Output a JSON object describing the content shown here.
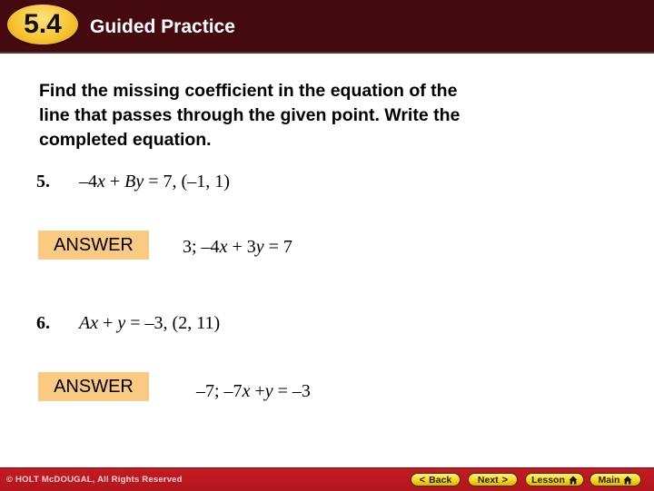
{
  "header": {
    "section_number": "5.4",
    "title": "Guided Practice"
  },
  "instructions": {
    "line1": "Find the missing coefficient in the equation of the",
    "line2": "line that passes through the given point. Write the",
    "line3": "completed equation."
  },
  "problems": [
    {
      "number": "5.",
      "equation_parts": [
        "–4",
        "x",
        " + ",
        "B",
        "y",
        " = 7, (–1, 1)"
      ],
      "answer_label": "ANSWER",
      "answer_parts": [
        "3; –4",
        "x",
        " + 3",
        "y",
        " = 7"
      ]
    },
    {
      "number": "6.",
      "equation_parts": [
        "A",
        "x",
        " + ",
        "y",
        " = –3, (2, 11)"
      ],
      "answer_label": "ANSWER",
      "answer_parts": [
        "–7; –7",
        "x",
        " +",
        "y",
        " = –3"
      ]
    }
  ],
  "footer": {
    "copyright": "© HOLT McDOUGAL, All Rights Reserved",
    "buttons": {
      "back": "Back",
      "next": "Next",
      "lesson": "Lesson",
      "main": "Main"
    },
    "icons": {
      "back": "chevron-left-icon",
      "next": "chevron-right-icon",
      "lesson": "home-icon",
      "main": "home-icon"
    }
  },
  "colors": {
    "header_bg": "#450a0f",
    "badge": "#f6c230",
    "answer_box": "#fac982",
    "footer_bg": "#c41a22",
    "nav_button": "#f3d31a"
  }
}
